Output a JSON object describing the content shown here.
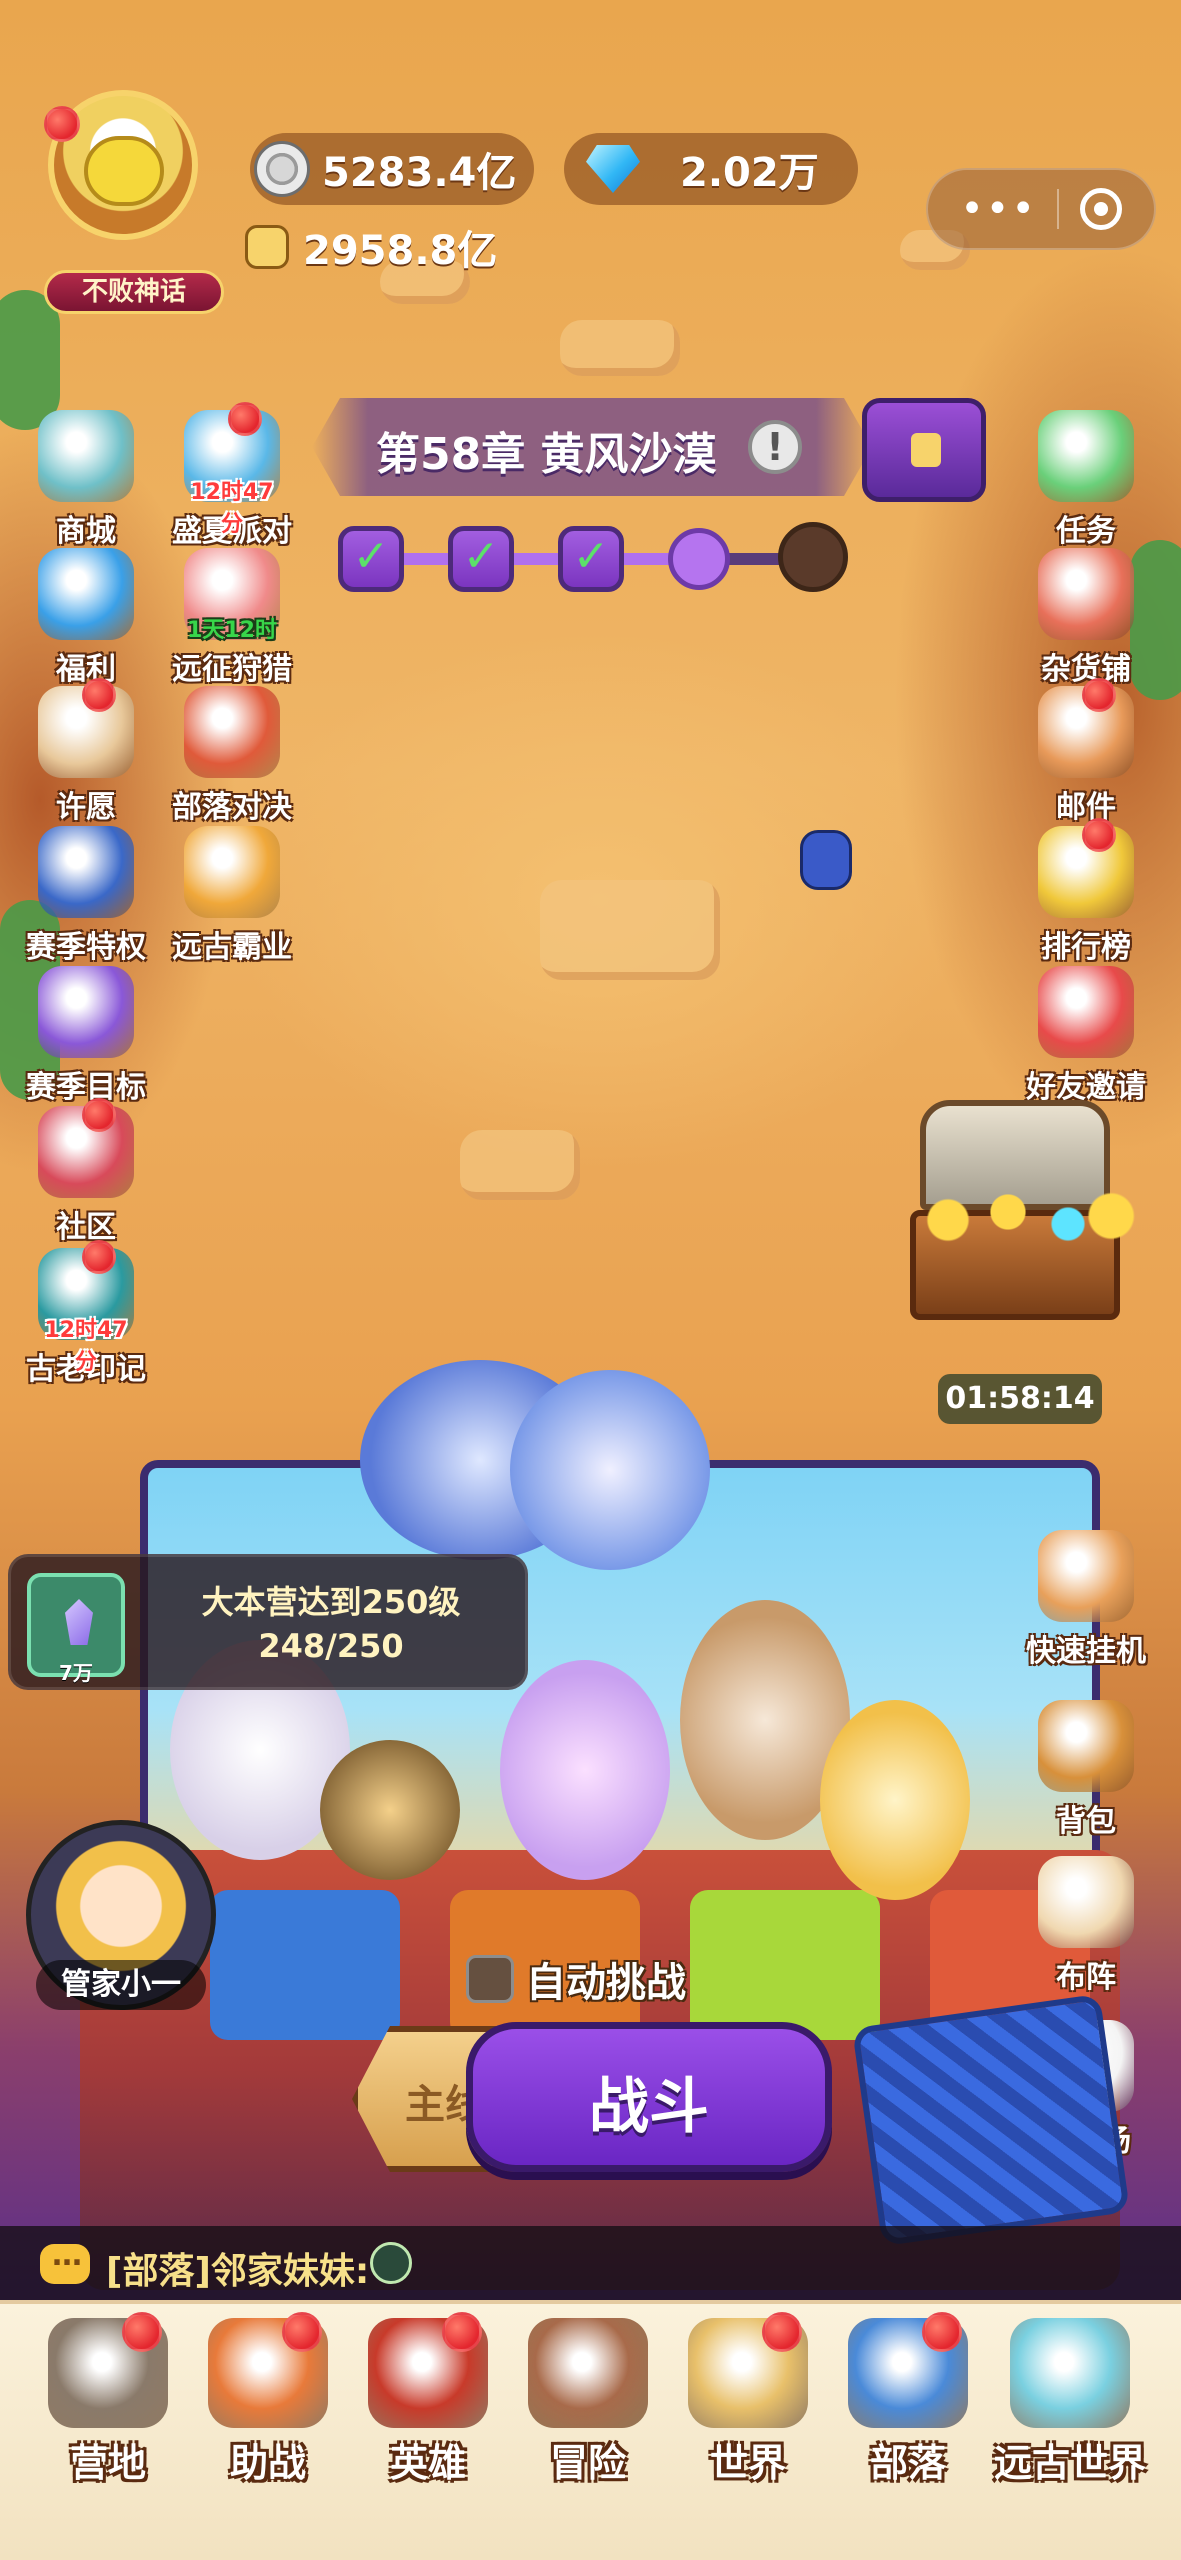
{
  "player": {
    "title_badge": "不败神话",
    "coins": "5283.4亿",
    "gems": "2.02万",
    "power": "2958.8亿"
  },
  "chapter": {
    "title": "第58章 黄风沙漠",
    "info_glyph": "!",
    "checkmark_glyph": "✓",
    "stages_completed": 3,
    "stages_total": 5
  },
  "left_menu": [
    {
      "label": "商城",
      "icon": "shop-totem-icon",
      "color": "#6fc0c8"
    },
    {
      "label": "福利",
      "icon": "gem-sack-icon",
      "color": "#3aa0e8"
    },
    {
      "label": "许愿",
      "icon": "wish-goddess-icon",
      "color": "#e8c89a"
    },
    {
      "label": "赛季特权",
      "icon": "season-card-icon",
      "color": "#3a68c8"
    },
    {
      "label": "赛季目标",
      "icon": "season-badge-icon",
      "color": "#8a58d8"
    },
    {
      "label": "社区",
      "icon": "community-diamond-icon",
      "color": "#d84a5a"
    },
    {
      "label": "古老印记",
      "icon": "ancient-rune-icon",
      "color": "#2a9aa0",
      "timer": "12时47分"
    }
  ],
  "mid_menu": [
    {
      "label": "盛夏派对",
      "icon": "flamingo-float-icon",
      "color": "#5ab8e8",
      "timer": "12时47分"
    },
    {
      "label": "远征狩猎",
      "icon": "hunt-egg-icon",
      "color": "#f08a8a",
      "timer": "1天12时",
      "timer_color": "green"
    },
    {
      "label": "部落对决",
      "icon": "crossed-swords-icon",
      "color": "#e05a3a"
    },
    {
      "label": "远古霸业",
      "icon": "golden-trophy-icon",
      "color": "#f0a83a"
    }
  ],
  "right_menu": [
    {
      "label": "任务",
      "icon": "task-clipboard-icon",
      "color": "#6ad07a"
    },
    {
      "label": "杂货铺",
      "icon": "grocery-stall-icon",
      "color": "#e8705a"
    },
    {
      "label": "邮件",
      "icon": "mail-envelope-icon",
      "color": "#e89a5a"
    },
    {
      "label": "排行榜",
      "icon": "ranking-podium-icon",
      "color": "#f0c83a"
    },
    {
      "label": "好友邀请",
      "icon": "gift-box-icon",
      "color": "#e84a4a"
    }
  ],
  "right_lower_menu": [
    {
      "label": "快速挂机",
      "icon": "hourglass-icon",
      "color": "#e8a05a"
    },
    {
      "label": "背包",
      "icon": "backpack-icon",
      "color": "#d8903a"
    },
    {
      "label": "布阵",
      "icon": "formation-flag-icon",
      "color": "#f0d8b0"
    },
    {
      "label": "游乐场",
      "icon": "gamepad-icon",
      "color": "#f4f4f4"
    }
  ],
  "treasure": {
    "timer": "01:58:14"
  },
  "quest": {
    "title": "大本营达到250级",
    "progress": "248/250",
    "reward_badge": "7万"
  },
  "butler_label": "管家小一",
  "auto_challenge_label": "自动挑战",
  "mainline_label": "主线",
  "fight_label": "战斗",
  "chat": {
    "tag": "[部落]",
    "sender": "邻家妹妹:"
  },
  "tabs": [
    {
      "label": "营地",
      "icon": "camp-anvil-icon",
      "color": "#8a7a6a",
      "dot": true
    },
    {
      "label": "助战",
      "icon": "fist-icon",
      "color": "#e87a3a",
      "dot": true
    },
    {
      "label": "英雄",
      "icon": "hero-helmet-icon",
      "color": "#c83a2a",
      "dot": true
    },
    {
      "label": "冒险",
      "icon": "spiked-boulder-icon",
      "color": "#a86a4a",
      "dot": false,
      "active": true
    },
    {
      "label": "世界",
      "icon": "world-map-icon",
      "color": "#e8c06a",
      "dot": true
    },
    {
      "label": "部落",
      "icon": "tribe-shield-icon",
      "color": "#4a8ad8",
      "dot": true
    },
    {
      "label": "远古世界",
      "icon": "ancient-world-icon",
      "color": "#7ad0e0",
      "dot": false
    }
  ]
}
